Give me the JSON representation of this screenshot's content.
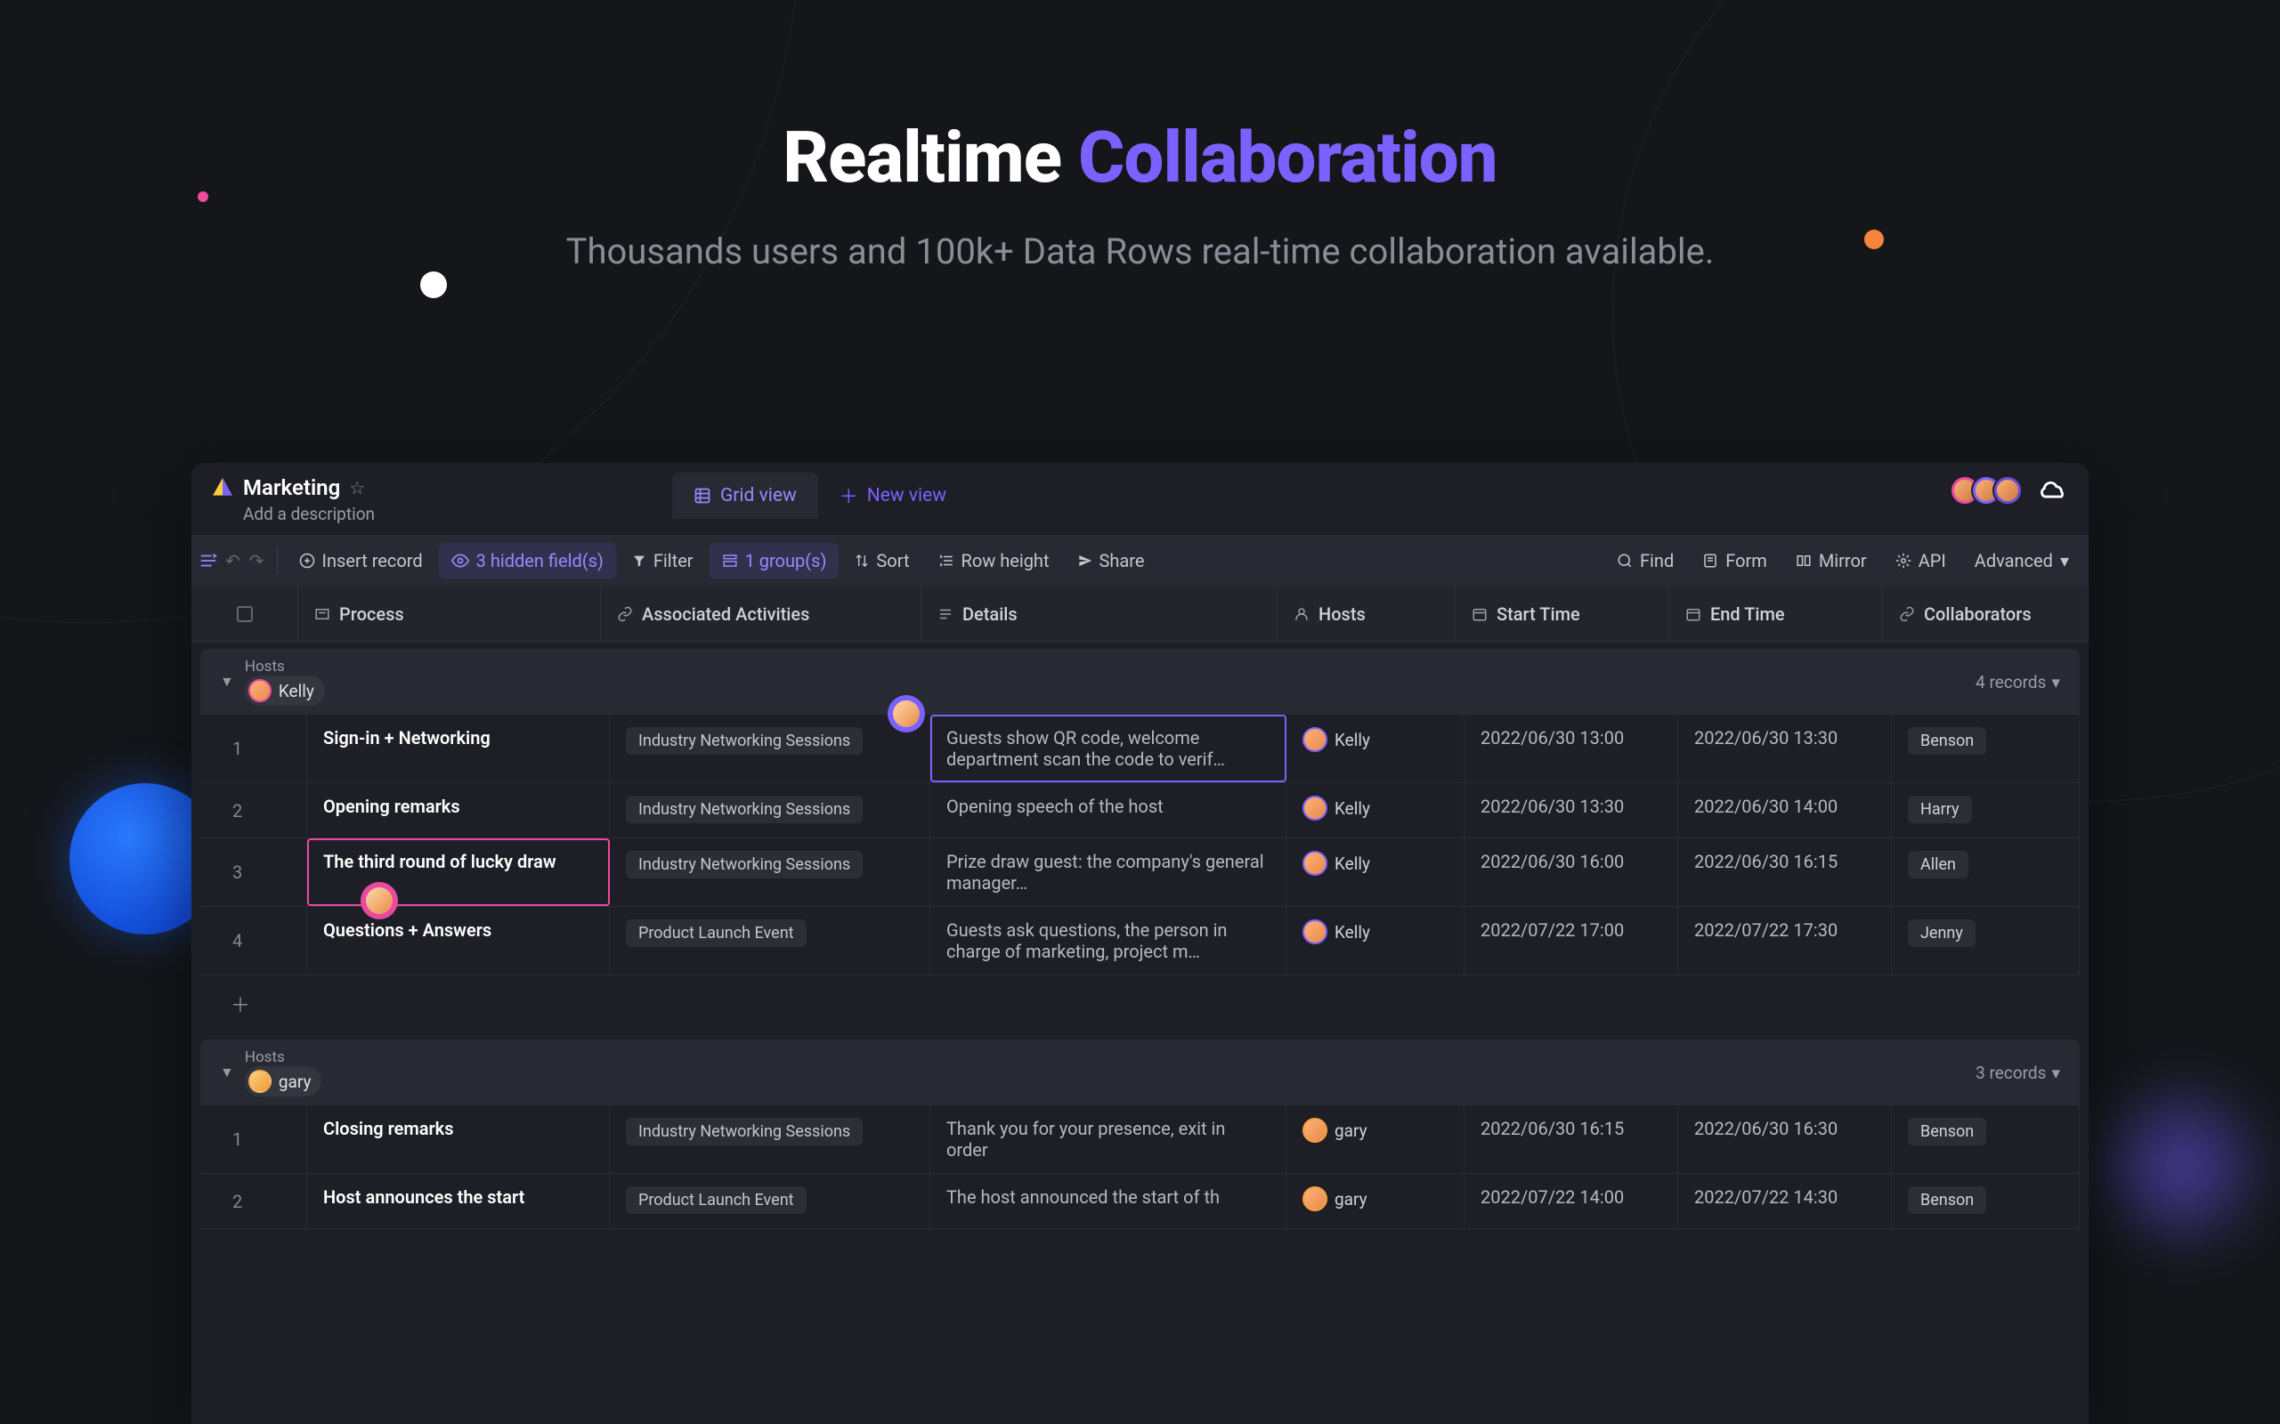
{
  "hero": {
    "title_a": "Realtime",
    "title_b": "Collaboration",
    "subtitle": "Thousands users and 100k+ Data Rows real-time collaboration available."
  },
  "app": {
    "title": "Marketing",
    "description": "Add a description"
  },
  "tabs": {
    "grid_view": "Grid view",
    "new_view": "New view"
  },
  "toolbar": {
    "insert_record": "Insert record",
    "hidden_fields": "3 hidden field(s)",
    "filter": "Filter",
    "groups": "1 group(s)",
    "sort": "Sort",
    "row_height": "Row height",
    "share": "Share",
    "find": "Find",
    "form": "Form",
    "mirror": "Mirror",
    "api": "API",
    "advanced": "Advanced"
  },
  "columns": {
    "c1": "Process",
    "c2": "Associated Activities",
    "c3": "Details",
    "c4": "Hosts",
    "c5": "Start Time",
    "c6": "End Time",
    "c7": "Collaborators"
  },
  "groups": [
    {
      "field": "Hosts",
      "name": "Kelly",
      "count": "4 records",
      "rows": [
        {
          "num": "1",
          "process": "Sign-in + Networking",
          "activity": "Industry Networking Sessions",
          "details": "Guests show QR code, welcome department scan the code to verif…",
          "host": "Kelly",
          "start": "2022/06/30 13:00",
          "end": "2022/06/30 13:30",
          "collab": "Benson"
        },
        {
          "num": "2",
          "process": "Opening remarks",
          "activity": "Industry Networking Sessions",
          "details": "Opening speech of the host",
          "host": "Kelly",
          "start": "2022/06/30 13:30",
          "end": "2022/06/30 14:00",
          "collab": "Harry"
        },
        {
          "num": "3",
          "process": "The third round of lucky draw",
          "activity": "Industry Networking Sessions",
          "details": "Prize draw guest: the company's general manager…",
          "host": "Kelly",
          "start": "2022/06/30 16:00",
          "end": "2022/06/30 16:15",
          "collab": "Allen"
        },
        {
          "num": "4",
          "process": "Questions + Answers",
          "activity": "Product Launch Event",
          "details": "Guests ask questions, the person in charge of marketing, project m…",
          "host": "Kelly",
          "start": "2022/07/22 17:00",
          "end": "2022/07/22 17:30",
          "collab": "Jenny"
        }
      ]
    },
    {
      "field": "Hosts",
      "name": "gary",
      "count": "3 records",
      "rows": [
        {
          "num": "1",
          "process": "Closing remarks",
          "activity": "Industry Networking Sessions",
          "details": "Thank you for your presence, exit in order",
          "host": "gary",
          "start": "2022/06/30 16:15",
          "end": "2022/06/30 16:30",
          "collab": "Benson"
        },
        {
          "num": "2",
          "process": "Host announces the start",
          "activity": "Product Launch Event",
          "details": "The host announced the start of th",
          "host": "gary",
          "start": "2022/07/22 14:00",
          "end": "2022/07/22 14:30",
          "collab": "Benson"
        }
      ]
    }
  ],
  "colors": {
    "accent_purple": "#7b61ff",
    "accent_pink": "#e94aa0"
  }
}
